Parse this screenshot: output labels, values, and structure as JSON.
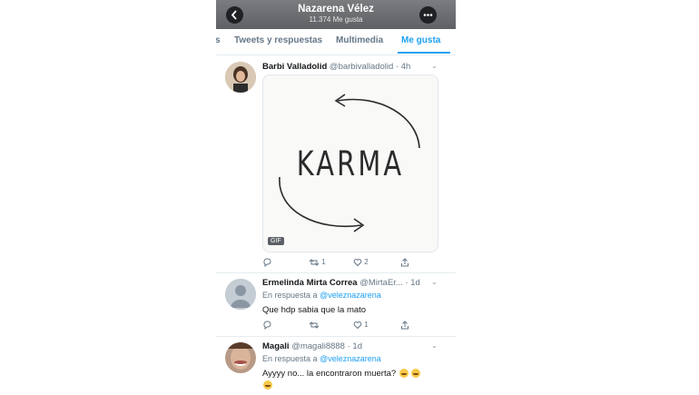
{
  "header": {
    "name": "Nazarena Vélez",
    "likes_count": "11.374 Me gusta",
    "back_icon": "back-arrow-icon",
    "more_icon": "more-dots-icon"
  },
  "tabs": [
    {
      "label": "s"
    },
    {
      "label": "Tweets y respuestas"
    },
    {
      "label": "Multimedia"
    },
    {
      "label": "Me gusta",
      "active": true
    }
  ],
  "colors": {
    "accent": "#1da1f2",
    "text": "#14171a",
    "muted": "#657786"
  },
  "tweets": [
    {
      "name": "Barbi Valladolid",
      "handle": "@barbivalladolid · 4h",
      "media_text": "KARMA",
      "media_badge": "GIF",
      "reply_count": "",
      "retweet_count": "1",
      "like_count": "2"
    },
    {
      "name": "Ermelinda Mirta Correa",
      "handle": "@MirtaEr... · 1d",
      "reply_prefix": "En respuesta a",
      "reply_mention": "@veleznazarena",
      "text": "Que hdp sabia que la mato",
      "reply_count": "",
      "retweet_count": "",
      "like_count": "1"
    },
    {
      "name": "Magali",
      "handle": "@magali8888 · 1d",
      "reply_prefix": "En respuesta a",
      "reply_mention": "@veleznazarena",
      "text": "Ayyyy no... la encontraron muerta?"
    }
  ]
}
